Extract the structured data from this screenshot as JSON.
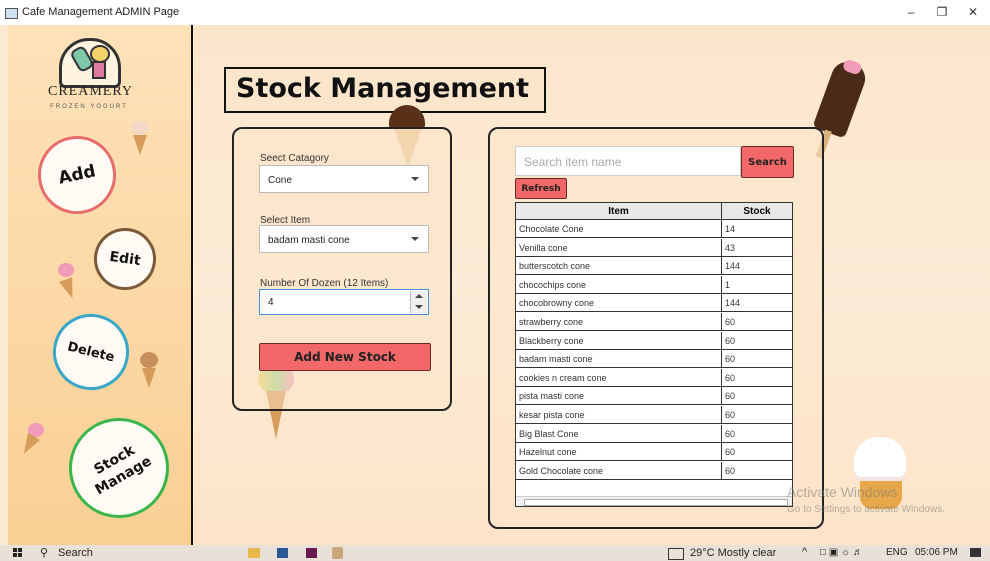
{
  "window": {
    "title": "Cafe Management ADMIN Page",
    "controls": [
      "minimize",
      "restore",
      "close"
    ]
  },
  "logo": {
    "brand": "CREAMERY",
    "tagline": "FROZEN YOGURT"
  },
  "sidebar": {
    "add_label": "Add",
    "edit_label": "Edit",
    "delete_label": "Delete",
    "stock_label_1": "Stock",
    "stock_label_2": "Manage"
  },
  "page_title": "Stock Management",
  "form": {
    "category_label": "Seect Catagory",
    "category_value": "Cone",
    "item_label": "Select Item",
    "item_value": "badam masti cone",
    "dozen_label": "Number Of Dozen (12 Items)",
    "dozen_value": "4",
    "add_button": "Add New Stock"
  },
  "search": {
    "placeholder": "Search item name",
    "button": "Search",
    "refresh": "Refresh"
  },
  "table": {
    "columns": [
      "Item",
      "Stock"
    ],
    "rows": [
      {
        "item": "Chocolate Cone",
        "stock": "14"
      },
      {
        "item": "Venilla cone",
        "stock": "43"
      },
      {
        "item": "butterscotch cone",
        "stock": "144"
      },
      {
        "item": "chocochips cone",
        "stock": "1"
      },
      {
        "item": "chocobrowny cone",
        "stock": "144"
      },
      {
        "item": "strawberry cone",
        "stock": "60"
      },
      {
        "item": "Blackberry cone",
        "stock": "60"
      },
      {
        "item": "badam masti cone",
        "stock": "60"
      },
      {
        "item": "cookies n cream cone",
        "stock": "60"
      },
      {
        "item": "pista masti cone",
        "stock": "60"
      },
      {
        "item": "kesar pista cone",
        "stock": "60"
      },
      {
        "item": "Big Blast Cone",
        "stock": "60"
      },
      {
        "item": "Hazelnut cone",
        "stock": "60"
      },
      {
        "item": "Gold Chocolate cone",
        "stock": "60"
      }
    ]
  },
  "watermark": {
    "line1": "Activate Windows",
    "line2": "Go to Settings to activate Windows."
  },
  "taskbar": {
    "search": "Search",
    "weather": "29°C  Mostly clear",
    "lang": "ENG",
    "time": "05:06 PM"
  },
  "colors": {
    "accent_red": "#f26767",
    "sidebar_bg": "#fbd7a3",
    "add_ring": "#e86a6a",
    "edit_ring": "#7a5a3a",
    "delete_ring": "#3aa6c9",
    "stock_ring": "#3ab54a"
  }
}
